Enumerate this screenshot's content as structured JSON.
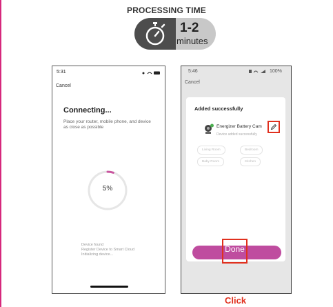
{
  "header": {
    "title": "PROCESSING TIME",
    "time_value": "1-2",
    "time_unit": "minutes",
    "icon": "stopwatch-icon"
  },
  "left_phone": {
    "status_time": "5:31",
    "cancel_label": "Cancel",
    "title": "Connecting...",
    "description": "Place your router, mobile phone, and device as close as possible",
    "progress_text": "5%",
    "progress_fraction": 0.05,
    "status_lines": [
      "Device found",
      "Register Device to Smart Cloud",
      "Initializing device..."
    ]
  },
  "right_phone": {
    "status_time": "5:46",
    "status_right": "100%",
    "cancel_label": "Cancel",
    "sheet_title": "Added successfully",
    "device_name": "Energizer Battery Cam",
    "device_status": "Device added successfully",
    "rooms": [
      "Living Room",
      "Bedroom",
      "Baby Room",
      "Kitchen"
    ],
    "done_label": "Done"
  },
  "instruction": "Click",
  "colors": {
    "accent": "#bf4c9f",
    "highlight": "#e0301e",
    "badge_dark": "#4d4d4d",
    "badge_light": "#c8c8c8"
  }
}
